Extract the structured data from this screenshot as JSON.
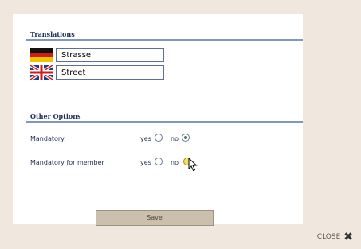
{
  "translations": {
    "title": "Translations",
    "rows": [
      {
        "flag": "germany-flag-icon",
        "value": "Strasse"
      },
      {
        "flag": "uk-flag-icon",
        "value": "Street"
      }
    ]
  },
  "other_options": {
    "title": "Other Options",
    "options": [
      {
        "label": "Mandatory",
        "yes_label": "yes",
        "no_label": "no",
        "selected": "no"
      },
      {
        "label": "Mandatory for member",
        "yes_label": "yes",
        "no_label": "no",
        "selected": "none"
      }
    ]
  },
  "save_label": "Save",
  "close_label": "CLOSE"
}
